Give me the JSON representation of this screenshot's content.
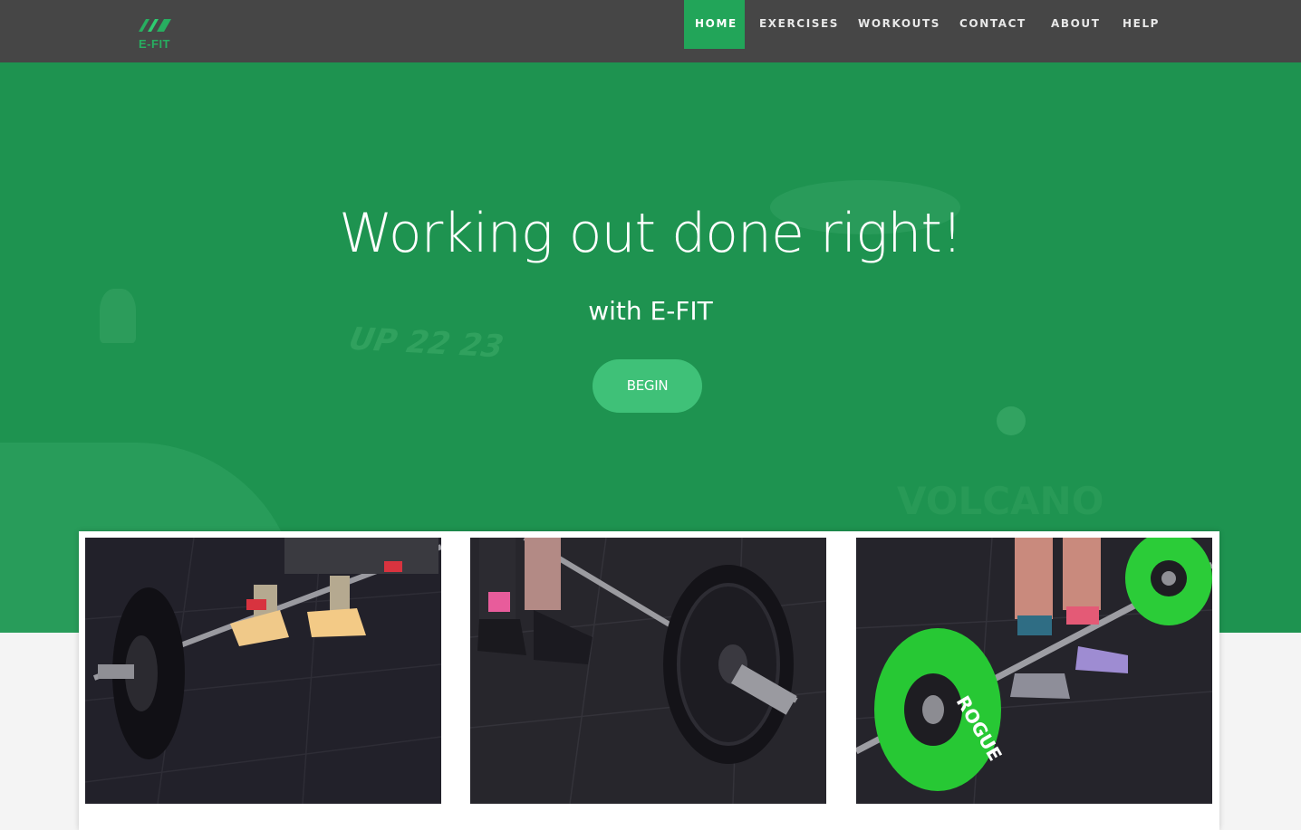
{
  "logo": {
    "text": "E-FIT",
    "icon": "efit-logo-icon"
  },
  "nav": {
    "items": [
      {
        "label": "HOME",
        "active": true
      },
      {
        "label": "EXERCISES",
        "active": false
      },
      {
        "label": "WORKOUTS",
        "active": false
      },
      {
        "label": "CONTACT",
        "active": false
      },
      {
        "label": "ABOUT",
        "active": false
      },
      {
        "label": "HELP",
        "active": false
      }
    ]
  },
  "hero": {
    "title": "Working out done right!",
    "subtitle": "with E-FIT",
    "button_label": "BEGIN",
    "background_text_1": "UP 22 23",
    "background_text_2": "VOLCANO"
  },
  "cards": [
    {
      "image": "deadlift-barbell-photo"
    },
    {
      "image": "barbell-plate-photo"
    },
    {
      "image": "rogue-green-plate-photo",
      "plate_text": "ROGUE"
    }
  ],
  "colors": {
    "accent": "#22a559",
    "hero": "#1e9350",
    "navbar": "#464646",
    "button": "#3fc178"
  }
}
